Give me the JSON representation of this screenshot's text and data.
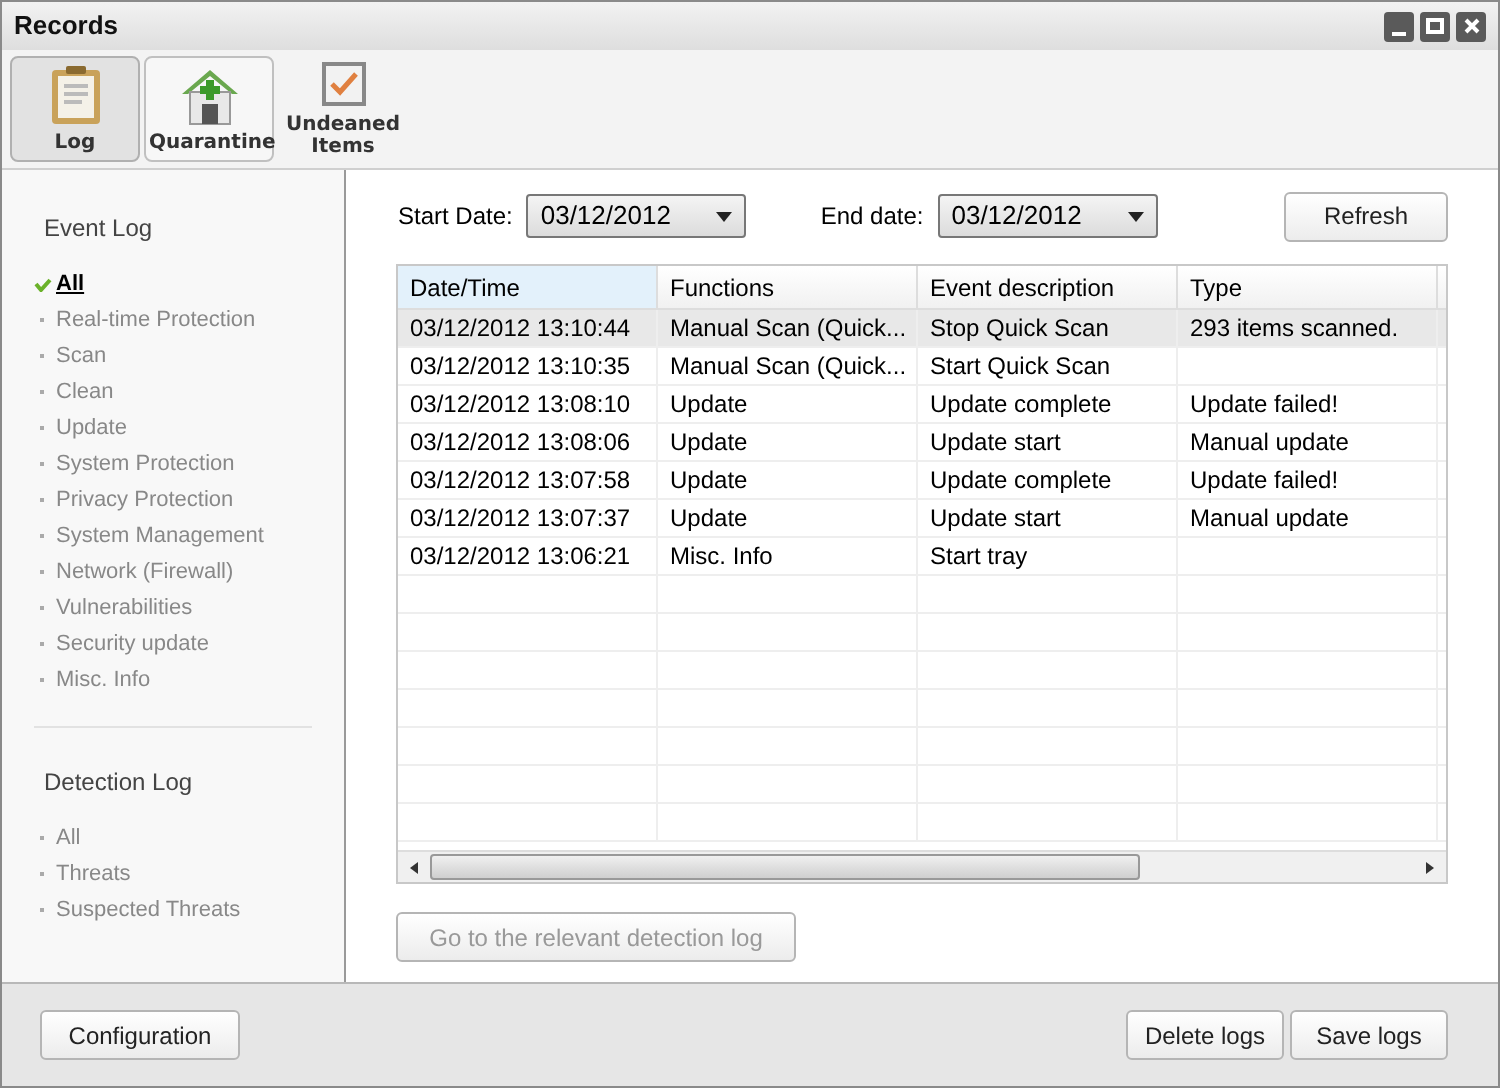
{
  "window": {
    "title": "Records"
  },
  "toolbar": [
    {
      "label": "Log",
      "kind": "log",
      "selected": true
    },
    {
      "label": "Quarantine",
      "kind": "quarantine",
      "selected": false,
      "highlighted": true
    },
    {
      "label": "Undeaned Items",
      "kind": "items",
      "selected": false,
      "highlighted": false
    }
  ],
  "sidebar": [
    {
      "heading": "Event Log",
      "items": [
        {
          "label": "All",
          "selected": true
        },
        {
          "label": "Real-time Protection",
          "selected": false
        },
        {
          "label": "Scan",
          "selected": false
        },
        {
          "label": "Clean",
          "selected": false
        },
        {
          "label": "Update",
          "selected": false
        },
        {
          "label": "System Protection",
          "selected": false
        },
        {
          "label": "Privacy Protection",
          "selected": false
        },
        {
          "label": "System Management",
          "selected": false
        },
        {
          "label": "Network (Firewall)",
          "selected": false
        },
        {
          "label": "Vulnerabilities",
          "selected": false
        },
        {
          "label": "Security update",
          "selected": false
        },
        {
          "label": "Misc. Info",
          "selected": false
        }
      ]
    },
    {
      "heading": "Detection Log",
      "items": [
        {
          "label": "All",
          "selected": false
        },
        {
          "label": "Threats",
          "selected": false
        },
        {
          "label": "Suspected Threats",
          "selected": false
        }
      ]
    }
  ],
  "filters": {
    "start_label": "Start Date:",
    "start_value": "03/12/2012",
    "end_label": "End date:",
    "end_value": "03/12/2012",
    "refresh": "Refresh"
  },
  "table": {
    "columns": [
      "Date/Time",
      "Functions",
      "Event description",
      "Type"
    ],
    "rows": [
      {
        "cells": [
          "03/12/2012 13:10:44",
          "Manual Scan (Quick...",
          "Stop Quick Scan",
          "293 items scanned."
        ],
        "selected": true
      },
      {
        "cells": [
          "03/12/2012 13:10:35",
          "Manual Scan (Quick...",
          "Start Quick Scan",
          ""
        ],
        "selected": false
      },
      {
        "cells": [
          "03/12/2012 13:08:10",
          "Update",
          "Update complete",
          "Update failed!"
        ],
        "selected": false
      },
      {
        "cells": [
          "03/12/2012 13:08:06",
          "Update",
          "Update start",
          "Manual update"
        ],
        "selected": false
      },
      {
        "cells": [
          "03/12/2012 13:07:58",
          "Update",
          "Update complete",
          "Update failed!"
        ],
        "selected": false
      },
      {
        "cells": [
          "03/12/2012 13:07:37",
          "Update",
          "Update start",
          "Manual update"
        ],
        "selected": false
      },
      {
        "cells": [
          "03/12/2012 13:06:21",
          "Misc. Info",
          "Start tray",
          ""
        ],
        "selected": false
      }
    ]
  },
  "goto_button": {
    "label": "Go to the relevant detection log",
    "disabled": true
  },
  "footer": {
    "left": [
      "Configuration"
    ],
    "right": [
      "Delete logs",
      "Save logs"
    ]
  }
}
